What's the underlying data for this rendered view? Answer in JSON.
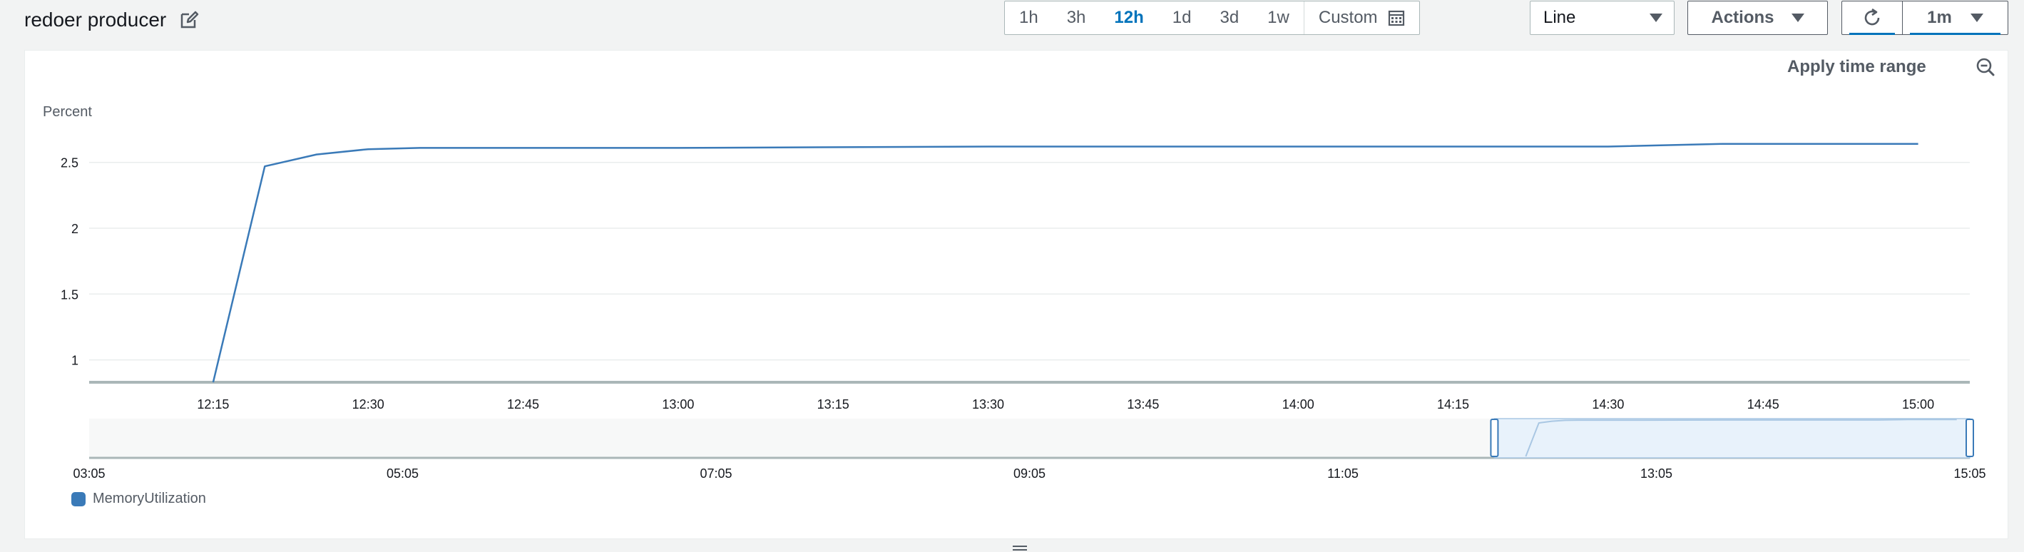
{
  "header": {
    "title": "redoer producer",
    "edit_icon": "edit-icon"
  },
  "time_ranges": {
    "items": [
      "1h",
      "3h",
      "12h",
      "1d",
      "3d",
      "1w"
    ],
    "active": "12h",
    "custom_label": "Custom"
  },
  "view_select": {
    "value": "Line"
  },
  "actions": {
    "label": "Actions"
  },
  "refresh": {
    "interval": "1m",
    "icon": "refresh-icon"
  },
  "panel": {
    "apply_time_range": "Apply time range",
    "zoom_icon": "zoom-out-icon"
  },
  "colors": {
    "series": "#3a7ab8",
    "accent": "#0073bb"
  },
  "chart_data": {
    "type": "line",
    "ylabel": "Percent",
    "y_ticks": [
      "1",
      "1.5",
      "2",
      "2.5"
    ],
    "ylim": [
      0.83,
      2.65
    ],
    "x_ticks": [
      "12:15",
      "12:30",
      "12:45",
      "13:00",
      "13:15",
      "13:30",
      "13:45",
      "14:00",
      "14:15",
      "14:30",
      "14:45",
      "15:00"
    ],
    "x_start": "12:03",
    "x_end": "15:05",
    "series": [
      {
        "name": "MemoryUtilization",
        "points": [
          [
            "12:15",
            0.83
          ],
          [
            "12:20",
            2.47
          ],
          [
            "12:25",
            2.56
          ],
          [
            "12:30",
            2.6
          ],
          [
            "12:35",
            2.61
          ],
          [
            "13:00",
            2.61
          ],
          [
            "13:30",
            2.62
          ],
          [
            "14:00",
            2.62
          ],
          [
            "14:30",
            2.62
          ],
          [
            "14:41",
            2.64
          ],
          [
            "15:00",
            2.64
          ]
        ]
      }
    ],
    "navigator": {
      "x_ticks": [
        "03:05",
        "05:05",
        "07:05",
        "09:05",
        "11:05",
        "13:05",
        "15:05"
      ],
      "x_start": "03:05",
      "x_end": "15:05",
      "selection_start": "12:03",
      "selection_end": "15:05"
    }
  }
}
